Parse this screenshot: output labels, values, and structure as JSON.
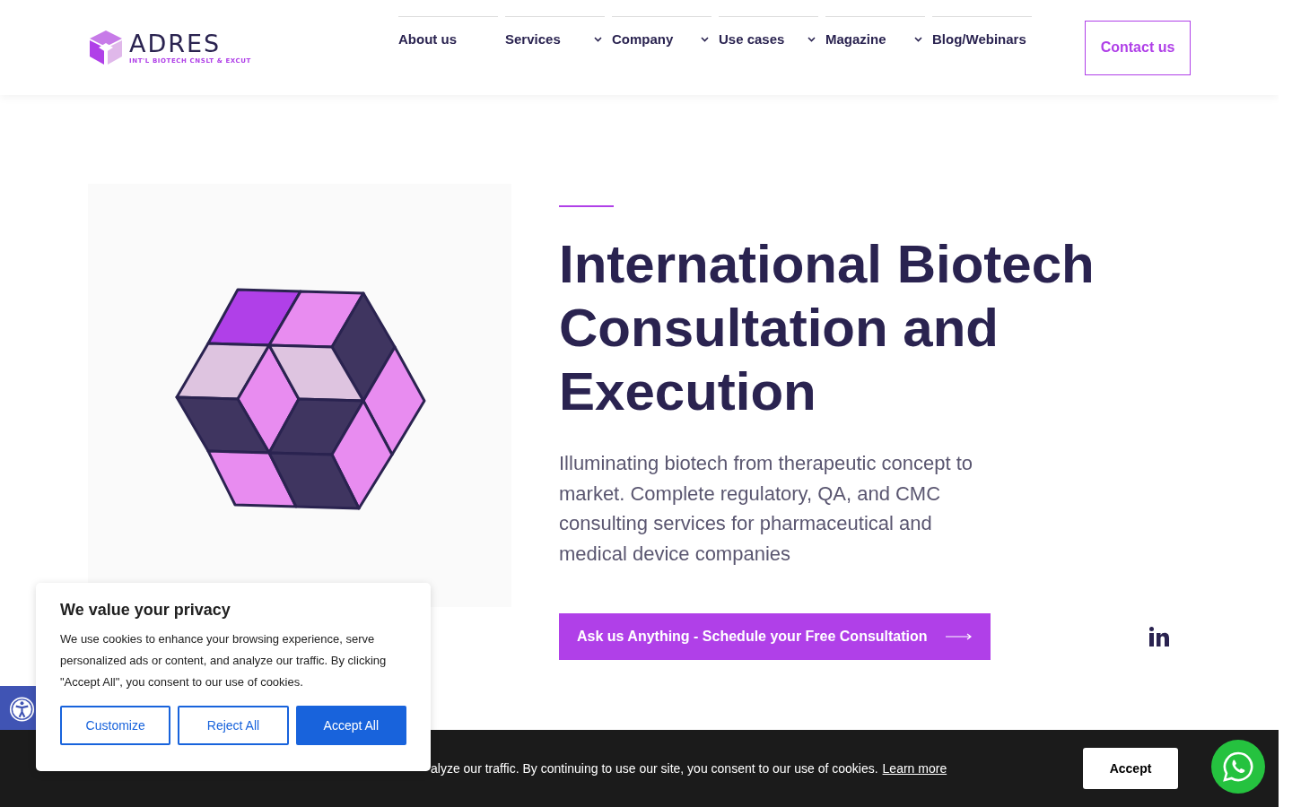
{
  "logo": {
    "name": "ADRES",
    "tagline": "INT'L BIOTECH CNSLT & EXCUT"
  },
  "nav": [
    {
      "label": "About us",
      "has_dropdown": false
    },
    {
      "label": "Services",
      "has_dropdown": true
    },
    {
      "label": "Company",
      "has_dropdown": true
    },
    {
      "label": "Use cases",
      "has_dropdown": true
    },
    {
      "label": "Magazine",
      "has_dropdown": true
    },
    {
      "label": "Blog/Webinars",
      "has_dropdown": false
    }
  ],
  "contact_button": "Contact us",
  "hero": {
    "title": "International Biotech Consultation and Execution",
    "subtitle": "Illuminating biotech from therapeutic concept to market. Complete regulatory, QA, and CMC consulting services for pharmaceutical and medical device companies",
    "cta": "Ask us Anything - Schedule your Free Consultation"
  },
  "cookie_bar": {
    "text": "alyze our traffic. By continuing to use our site, you consent to our use of cookies.",
    "link": "Learn more",
    "button": "Accept"
  },
  "privacy": {
    "title": "We value your privacy",
    "text": "We use cookies to enhance your browsing experience, serve personalized ads or content, and analyze our traffic. By clicking \"Accept All\", you consent to our use of cookies.",
    "buttons": [
      {
        "label": "Customize",
        "primary": false
      },
      {
        "label": "Reject All",
        "primary": false
      },
      {
        "label": "Accept All",
        "primary": true
      }
    ]
  }
}
